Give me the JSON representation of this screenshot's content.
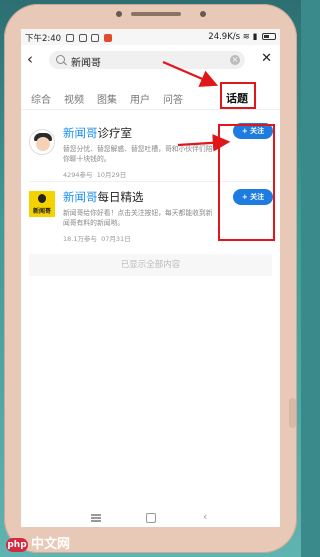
{
  "status_bar": {
    "time": "下午2:40",
    "speed": "24.9K/s",
    "icons": [
      "wifi-icon",
      "signal-icon",
      "battery-icon"
    ]
  },
  "search": {
    "query": "新闻哥"
  },
  "tabs": [
    {
      "label": "综合"
    },
    {
      "label": "视频"
    },
    {
      "label": "图集"
    },
    {
      "label": "用户"
    },
    {
      "label": "问答"
    },
    {
      "label": "话题",
      "active": true
    }
  ],
  "results": [
    {
      "title_highlight": "新闻哥",
      "title_rest": "诊疗室",
      "description": "替您分忧、替您解惑、替您吐槽，哥和小伙伴们陪你聊十块钱的。",
      "participants": "4294参与",
      "date": "10月29日",
      "follow_label": "+ 关注"
    },
    {
      "title_highlight": "新闻哥",
      "title_rest": "每日精选",
      "avatar_text": "新闻哥",
      "description": "新闻哥给你好看！点击关注按钮，每天都能收到新闻哥有料的新闻哟。",
      "participants": "18.1万参与",
      "date": "07月31日",
      "follow_label": "+ 关注"
    }
  ],
  "all_shown": "已显示全部内容",
  "watermark": {
    "logo": "php",
    "text": "中文网"
  },
  "colors": {
    "accent": "#1e7ce0",
    "highlight_red": "#e0161a"
  }
}
